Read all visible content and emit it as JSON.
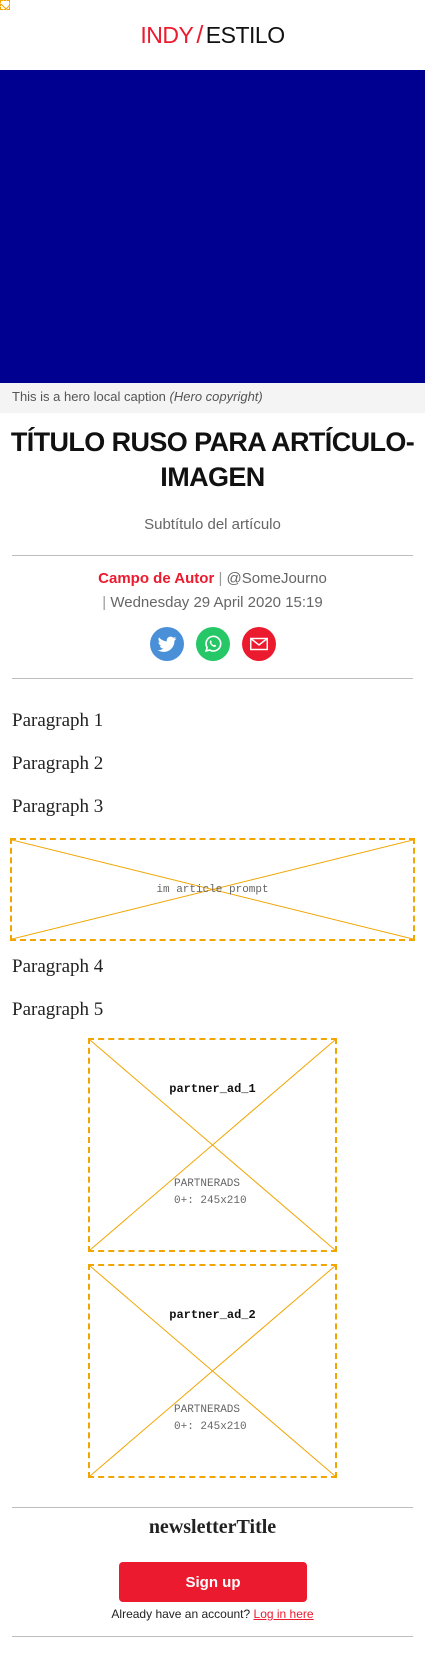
{
  "brand": {
    "part1": "INDY",
    "divider": "/",
    "part2": "ESTILO"
  },
  "hero": {
    "caption": "This is a hero local caption",
    "copyright": "(Hero copyright)"
  },
  "article": {
    "title": "TÍTULO RUSO PARA ARTÍCULO-IMAGEN",
    "subtitle": "Subtítulo del artículo",
    "author": "Campo de Autor",
    "handle": "@SomeJourno",
    "date": "Wednesday 29 April 2020 15:19",
    "paragraphs": [
      "Paragraph 1",
      "Paragraph 2",
      "Paragraph 3",
      "Paragraph 4",
      "Paragraph 5"
    ]
  },
  "share": {
    "icons": [
      "twitter-icon",
      "whatsapp-icon",
      "email-icon"
    ]
  },
  "placeholders": {
    "prompt": "im article prompt",
    "ads": [
      {
        "slot": "partner_ad_1",
        "type": "PARTNERADS",
        "size": "0+: 245x210"
      },
      {
        "slot": "partner_ad_2",
        "type": "PARTNERADS",
        "size": "0+: 245x210"
      }
    ]
  },
  "newsletter": {
    "title": "newsletterTitle",
    "signup_label": "Sign up",
    "account_text": "Already have an account?",
    "login_label": "Log in here"
  },
  "colors": {
    "brand_red": "#ec1a2e",
    "hero_blue": "#000090",
    "placeholder_orange": "#f0a500"
  }
}
